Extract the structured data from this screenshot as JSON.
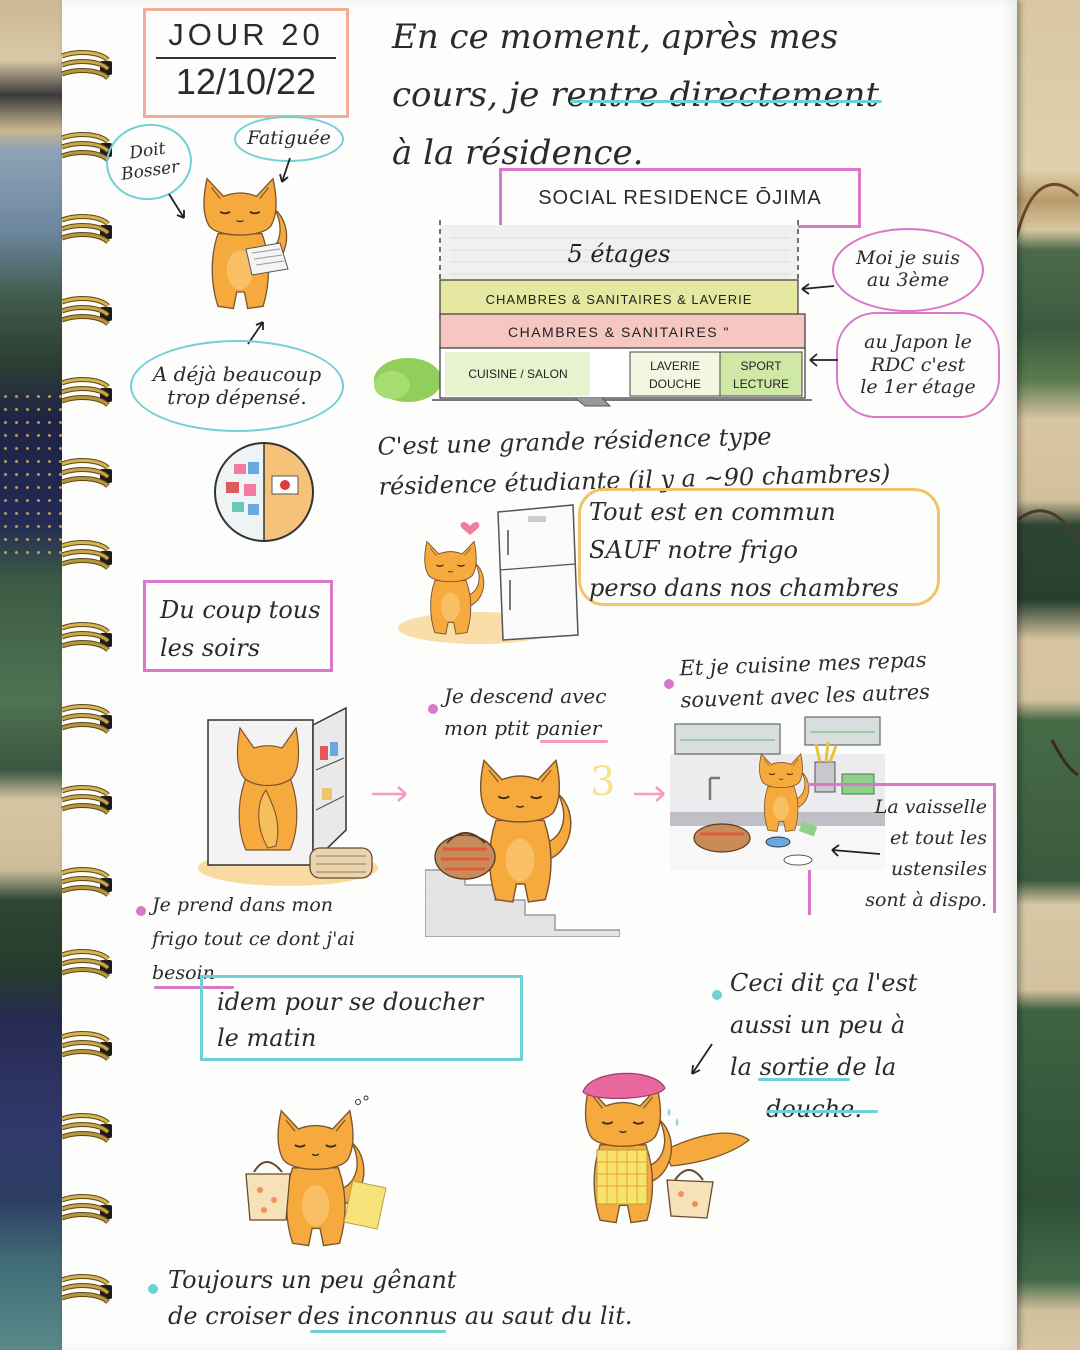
{
  "header": {
    "day": "JOUR 20",
    "date": "12/10/22"
  },
  "intro": {
    "lines": [
      "En ce moment, après mes",
      "cours, je rentre directement",
      "à la résidence."
    ]
  },
  "fox_tired": {
    "label_left": [
      "Doit",
      "Bosser"
    ],
    "label_right": "Fatiguée",
    "label_bottom": [
      "A déjà beaucoup",
      "trop dépensé."
    ]
  },
  "residence": {
    "title": "SOCIAL RESIDENCE ŌJIMA",
    "top": "5 étages",
    "floor3": "CHAMBRES & SANITAIRES & LAVERIE",
    "floor2": "CHAMBRES & SANITAIRES \"",
    "ground": {
      "kitchen": "CUISINE / SALON",
      "laundry": [
        "LAVERIE",
        "DOUCHE"
      ],
      "sport": [
        "SPORT",
        "LECTURE"
      ]
    },
    "note_floor": [
      "Moi je suis",
      "au 3ème"
    ],
    "note_japan": [
      "au Japon le",
      "RDC c'est",
      "le 1er étage"
    ]
  },
  "description": [
    "C'est une grande résidence type",
    "résidence étudiante (il y a ~90 chambres)"
  ],
  "shared": [
    "Tout est en commun",
    "SAUF notre frigo",
    "perso dans nos chambres"
  ],
  "evening": {
    "title": [
      "Du coup tous",
      "les soirs"
    ],
    "step1": [
      "Je prend dans mon",
      "frigo tout ce dont j'ai",
      "besoin"
    ],
    "step2": [
      "Je descend avec",
      "mon ptit panier"
    ],
    "step2_mark": "3",
    "step3": [
      "Et je cuisine mes repas",
      "souvent avec les autres"
    ],
    "dishes": [
      "La vaisselle",
      "et tout les",
      "ustensiles",
      "sont à dispo."
    ]
  },
  "morning": {
    "title": [
      "idem pour se doucher",
      "le matin"
    ],
    "note": [
      "Ceci dit ça l'est",
      "aussi un peu à",
      "la sortie de la",
      "douche."
    ],
    "footer": [
      "Toujours un peu gênant",
      "de croiser des inconnus au saut du lit."
    ]
  },
  "colors": {
    "cyan": "#6fd0d6",
    "magenta": "#d978c8",
    "peach": "#f3ad97",
    "fox": "#f6aa3e",
    "yellow": "#f1c46a",
    "pink": "#f59ac6"
  }
}
